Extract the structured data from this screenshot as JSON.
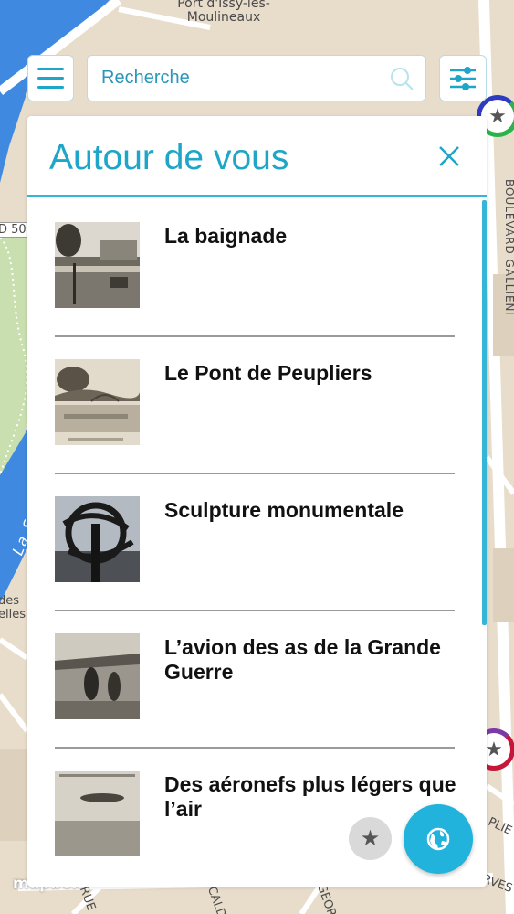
{
  "map": {
    "labels": {
      "port": "Port d'Issy-les-Moulineaux",
      "seine": "La Seine",
      "road_number": "D 50",
      "left_place": "des\nelles",
      "boulevard": "BOULEVARD GALLIENI",
      "street_bottom_1": "RUE",
      "street_bottom_2": "CALDI",
      "street_bottom_3": "GEORGE",
      "street_right_1": "PLIE",
      "street_right_2": "ORVES",
      "attribution": "mapbox"
    },
    "pins": [
      {
        "icon": "star-icon",
        "ring_colors": [
          "#2e3bbf",
          "#2ab34a"
        ]
      },
      {
        "icon": "star-icon",
        "ring_colors": [
          "#7a3aa6",
          "#c5173a"
        ]
      }
    ]
  },
  "toolbar": {
    "search_placeholder": "Recherche",
    "menu_icon": "hamburger-icon",
    "search_icon": "magnifier-icon",
    "filter_icon": "sliders-icon"
  },
  "panel": {
    "title": "Autour de vous",
    "close_icon": "close-icon",
    "items": [
      {
        "title": "La baignade"
      },
      {
        "title": "Le Pont de Peupliers"
      },
      {
        "title": "Sculpture monumentale"
      },
      {
        "title": "L’avion des as de la Grande Guerre"
      },
      {
        "title": "Des aéronefs plus légers que l’air"
      }
    ]
  },
  "floating": {
    "favorites_icon": "star-icon",
    "globe_icon": "globe-icon"
  },
  "colors": {
    "accent": "#1ea6c8",
    "accent_bright": "#22b3dc",
    "map_water": "#3f8ae0",
    "map_park": "#c9dfb0",
    "map_land": "#e8dccb"
  }
}
